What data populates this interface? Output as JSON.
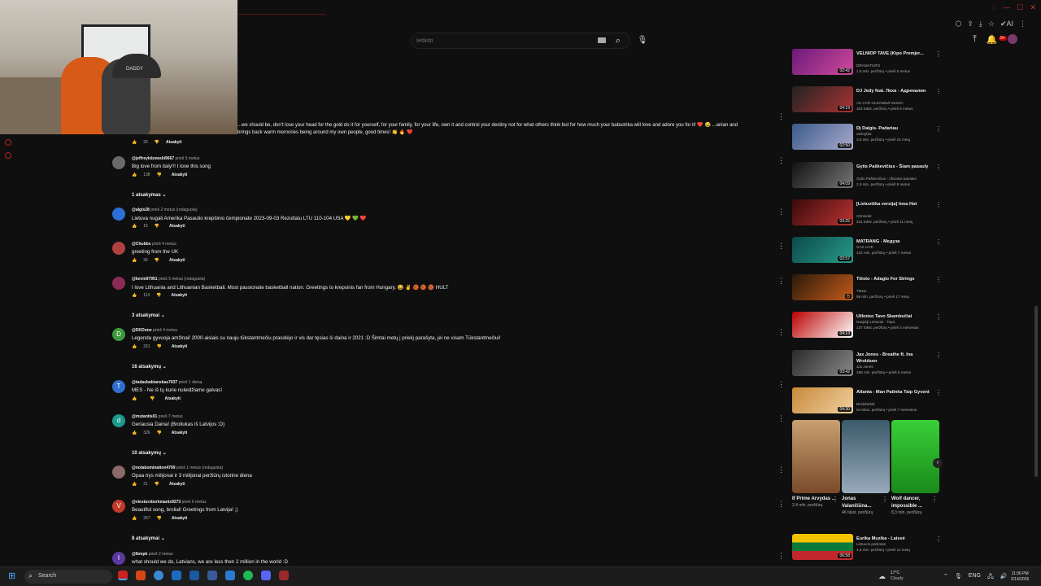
{
  "search": {
    "placeholder": "Ieškoti"
  },
  "webcam": {
    "cap_text": "DADDY"
  },
  "banner_comment": {
    "text": "...we should be, don't lose your head for the gold do it for yourself, for your family, for your life, own it and control your destiny not for what others think but for how much your babushka will love and adore you for it! ❤️ 😂  ...anian and brings back warm memories being around my own people, good times! 👏 🔥 ❤️",
    "likes": "26",
    "reply_label": "Atsakyti"
  },
  "comments": [
    {
      "avatar_letter": "",
      "avatar_color": "#6a6a6a",
      "author": "@jeffreylebowski9667",
      "time": "prieš 5 metus",
      "text": "Big love from italy!!! I love this song",
      "likes": "138",
      "reply_label": "Atsakyti",
      "replies": "1 atsakymas"
    },
    {
      "avatar_letter": "",
      "avatar_color": "#2d6fd6",
      "author": "@algis28",
      "time": "prieš 2 metus (redaguota)",
      "text": "Lietuva nugali Amerika Pasaulio krepšinio čempionate 2023-09-03 Rezultatu  LTU 110-104 USA 💛 💚 ❤️",
      "likes": "15",
      "reply_label": "Atsakyti",
      "replies": ""
    },
    {
      "avatar_letter": "",
      "avatar_color": "#b04040",
      "author": "@Chubbs",
      "time": "prieš 4 metus",
      "text": "greeting from the UK",
      "likes": "36",
      "reply_label": "Atsakyti",
      "replies": ""
    },
    {
      "avatar_letter": "",
      "avatar_color": "#8a2a55",
      "author": "@kevin97951",
      "time": "prieš 5 metus (redaguota)",
      "text": "I love Lithuania and Lithuanian Basketball. Most passionate basketball nation. Greetings to krepsinis fan from Hungary. 😀 ✌️ 🏀 🏀 🏀 HULT",
      "likes": "113",
      "reply_label": "Atsakyti",
      "replies": "3 atsakymai"
    },
    {
      "avatar_letter": "D",
      "avatar_color": "#3d9a3d",
      "author": "@DKDone",
      "time": "prieš 4 metus",
      "text": "Legenda gyvuoja amžinai! 2000-aisiais su nauju tūkstantmečiu prasidėjo ir vis dar tęsias ši daina ir 2021 :D Šimtai metų į priekį parašyta, jei ne visam Tūkstantmečiui!",
      "likes": "261",
      "reply_label": "Atsakyti",
      "replies": "16 atsakymų"
    },
    {
      "avatar_letter": "T",
      "avatar_color": "#2f6ed0",
      "author": "@tadasbabianskas7637",
      "time": "prieš 1 dieną",
      "text": "MES - Ne iš tų kurie nuleidžiame galvas!",
      "likes": "",
      "reply_label": "Atsakyti",
      "replies": ""
    },
    {
      "avatar_letter": "d",
      "avatar_color": "#1a9a8a",
      "author": "@mutantis01",
      "time": "prieš 7 metus",
      "text": "Geriausia Daina! (Broliukas iš Latvijos :D)",
      "likes": "326",
      "reply_label": "Atsakyti",
      "replies": "10 atsakymų"
    },
    {
      "avatar_letter": "",
      "avatar_color": "#8a6a6a",
      "author": "@notabomination4799",
      "time": "prieš 1 metus (redaguota)",
      "text": "Opaa trys milijonai ir 3 milijonai peržiūrų istorine diena",
      "likes": "21",
      "reply_label": "Atsakyti",
      "replies": ""
    },
    {
      "avatar_letter": "V",
      "avatar_color": "#c0392b",
      "author": "@viestursberkmanis9273",
      "time": "prieš 6 metus",
      "text": "Beautiful song, brolial! Greetings from Latvija! ;)",
      "likes": "267",
      "reply_label": "Atsakyti",
      "replies": "8 atsakymai"
    },
    {
      "avatar_letter": "I",
      "avatar_color": "#5a3aa0",
      "author": "@Ikmpk",
      "time": "prieš 2 metus",
      "text": "what should we do, Latvians, we are less then 2 million in the world :D",
      "likes": "",
      "reply_label": "",
      "replies": ""
    }
  ],
  "sidebar": [
    {
      "title": "VELNIOP TAVE (Kipo Premjer...",
      "channel": "DRAMATURG",
      "stats": "1,8 mln. peržiūrų • prieš 5 metus",
      "duration": "02:42",
      "c1": "#6a1a7a",
      "c2": "#d14a9a"
    },
    {
      "title": "DJ Jedy feat. Леха - Адреналин",
      "channel": "AS CAR OLDANEW MUSIC",
      "stats": "104 tūkst. peržiūrų • prieš 8 metus",
      "duration": "04:19",
      "c1": "#222",
      "c2": "#a33"
    },
    {
      "title": "Dj Dalgis- Padariau",
      "channel": "oxiroyfas",
      "stats": "3,5 mln. peržiūrų • prieš 16 metų",
      "duration": "02:50",
      "c1": "#3a5a8a",
      "c2": "#aac"
    },
    {
      "title": "Gytis Paškevičius - Šiam pasauly",
      "channel": "Gytis Paškevičius - oficialus kanalas",
      "stats": "2,9 mln. peržiūrų • prieš 8 metus",
      "duration": "04:09",
      "c1": "#111",
      "c2": "#777"
    },
    {
      "title": "[Lietuviška versija] Inna Hot",
      "channel": "G3noider",
      "stats": "231 tūkst. peržiūrų • prieš 11 metų",
      "duration": "03:25",
      "c1": "#3a0a0a",
      "c2": "#b33"
    },
    {
      "title": "MATRANG - Медуза",
      "channel": "GAZ LIVE",
      "stats": "142 mln. peržiūrų • prieš 7 metus",
      "duration": "02:57",
      "c1": "#0a4a4a",
      "c2": "#2a9a8a"
    },
    {
      "title": "Tiësto - Adagio For Strings",
      "channel": "Tiësto",
      "stats": "59 mln. peržiūrų • prieš 17 metų",
      "duration": "",
      "c1": "#2a1a0a",
      "c2": "#c55a1a"
    },
    {
      "title": "Užkniso Tavo Skambučiai",
      "channel": "Naujieji Lietuviai - Topic",
      "stats": "137 tūkst. peržiūrų • prieš 4 mėnesius",
      "duration": "04:13",
      "c1": "#b00",
      "c2": "#fff"
    },
    {
      "title": "Jax Jones - Breathe ft. Ina Wroldsen",
      "channel": "Jax Jones",
      "stats": "198 mln. peržiūrų • prieš 8 metus",
      "duration": "03:42",
      "c1": "#2a2a2a",
      "c2": "#8a8a8a"
    },
    {
      "title": "Atlanta - Man Patinka Taip Gyvent",
      "channel": "Brickthekid",
      "stats": "64 tūkst. peržiūrų • prieš 7 mėnesius",
      "duration": "04:30",
      "c1": "#c88a3a",
      "c2": "#f0d0a0"
    }
  ],
  "shorts": [
    {
      "title": "If Prime Arvydas ...",
      "views": "2,4 mln. peržiūrų",
      "c1": "#c8a070",
      "c2": "#7a4a2a"
    },
    {
      "title": "Jonas Valančiūna...",
      "views": "46 tūkst. peržiūrų",
      "c1": "#3a5a6a",
      "c2": "#9ab"
    },
    {
      "title": "Wolf dancer, impossible ...",
      "views": "8,3 mln. peržiūrų",
      "c1": "#38d038",
      "c2": "#1a8a1a"
    }
  ],
  "last_video": {
    "title": "Eurika Muzika - Laisvė",
    "channel": "Lietuvos patriotas",
    "stats": "4,6 mln. peržiūrų • prieš 11 metų",
    "duration": "06:58"
  },
  "taskbar": {
    "search_label": "Search",
    "temp": "17°C",
    "weather": "Cloudy",
    "lang": "ENG",
    "time": "11:06 PM",
    "date": "2/14/2026"
  },
  "browser": {
    "ai_label": "AI"
  }
}
